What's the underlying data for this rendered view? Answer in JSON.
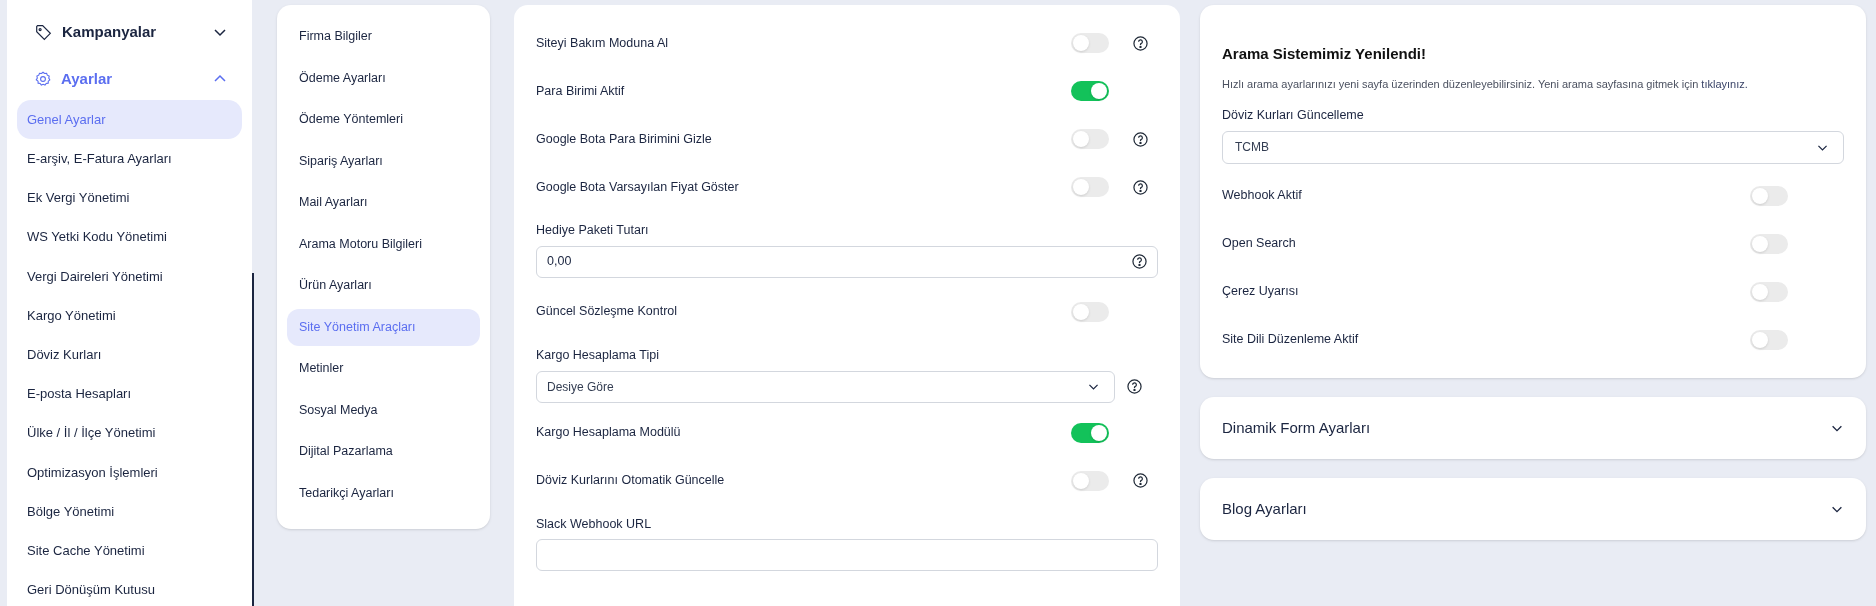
{
  "sidebar": {
    "groups": [
      {
        "label": "Kampanyalar",
        "expanded": false
      },
      {
        "label": "Ayarlar",
        "expanded": true,
        "items": [
          {
            "label": "Genel Ayarlar",
            "selected": true
          },
          {
            "label": "E-arşiv, E-Fatura Ayarları",
            "selected": false
          },
          {
            "label": "Ek Vergi Yönetimi",
            "selected": false
          },
          {
            "label": "WS Yetki Kodu Yönetimi",
            "selected": false
          },
          {
            "label": "Vergi Daireleri Yönetimi",
            "selected": false
          },
          {
            "label": "Kargo Yönetimi",
            "selected": false
          },
          {
            "label": "Döviz Kurları",
            "selected": false
          },
          {
            "label": "E-posta Hesapları",
            "selected": false
          },
          {
            "label": "Ülke / İl / İlçe Yönetimi",
            "selected": false
          },
          {
            "label": "Optimizasyon İşlemleri",
            "selected": false
          },
          {
            "label": "Bölge Yönetimi",
            "selected": false
          },
          {
            "label": "Site Cache Yönetimi",
            "selected": false
          },
          {
            "label": "Geri Dönüşüm Kutusu",
            "selected": false
          }
        ]
      }
    ]
  },
  "settings_nav": [
    {
      "label": "Firma Bilgiler",
      "selected": false
    },
    {
      "label": "Ödeme Ayarları",
      "selected": false
    },
    {
      "label": "Ödeme Yöntemleri",
      "selected": false
    },
    {
      "label": "Sipariş Ayarları",
      "selected": false
    },
    {
      "label": "Mail Ayarları",
      "selected": false
    },
    {
      "label": "Arama Motoru Bilgileri",
      "selected": false
    },
    {
      "label": "Ürün Ayarları",
      "selected": false
    },
    {
      "label": "Site Yönetim Araçları",
      "selected": true
    },
    {
      "label": "Metinler",
      "selected": false
    },
    {
      "label": "Sosyal Medya",
      "selected": false
    },
    {
      "label": "Dijital Pazarlama",
      "selected": false
    },
    {
      "label": "Tedarikçi Ayarları",
      "selected": false
    }
  ],
  "main_settings": [
    {
      "kind": "toggle",
      "label": "Siteyi Bakım Moduna Al",
      "on": false,
      "help": true
    },
    {
      "kind": "toggle",
      "label": "Para Birimi Aktif",
      "on": true,
      "help": false
    },
    {
      "kind": "toggle",
      "label": "Google Bota Para Birimini Gizle",
      "on": false,
      "help": true
    },
    {
      "kind": "toggle",
      "label": "Google Bota Varsayılan Fiyat Göster",
      "on": false,
      "help": true
    },
    {
      "kind": "input",
      "label": "Hediye Paketi Tutarı",
      "value": "0,00",
      "help": true
    },
    {
      "kind": "toggle",
      "label": "Güncel Sözleşme Kontrol",
      "on": false,
      "help": false
    },
    {
      "kind": "select",
      "label": "Kargo Hesaplama Tipi",
      "value": "Desiye Göre",
      "help": true
    },
    {
      "kind": "toggle",
      "label": "Kargo Hesaplama Modülü",
      "on": true,
      "help": false
    },
    {
      "kind": "toggle",
      "label": "Döviz Kurlarını Otomatik Güncelle",
      "on": false,
      "help": true
    },
    {
      "kind": "input",
      "label": "Slack Webhook URL",
      "help": false
    }
  ],
  "search_card": {
    "title": "Arama Sistemimiz Yenilendi!",
    "text": "Hızlı arama ayarlarınızı yeni sayfa üzerinden düzenleyebilirsiniz. Yeni arama sayfasına gitmek için",
    "link": "tıklayınız.",
    "fields": [
      {
        "kind": "select",
        "label": "Döviz Kurları Güncelleme",
        "value": "TCMB"
      },
      {
        "kind": "toggle",
        "label": "Webhook Aktif",
        "on": false
      },
      {
        "kind": "toggle",
        "label": "Open Search",
        "on": false
      },
      {
        "kind": "toggle",
        "label": "Çerez Uyarısı",
        "on": false
      },
      {
        "kind": "toggle",
        "label": "Site Dili Düzenleme Aktif",
        "on": false
      }
    ]
  },
  "accordions": [
    {
      "title": "Dinamik Form Ayarları",
      "expanded": false
    },
    {
      "title": "Blog Ayarları",
      "expanded": false
    }
  ]
}
